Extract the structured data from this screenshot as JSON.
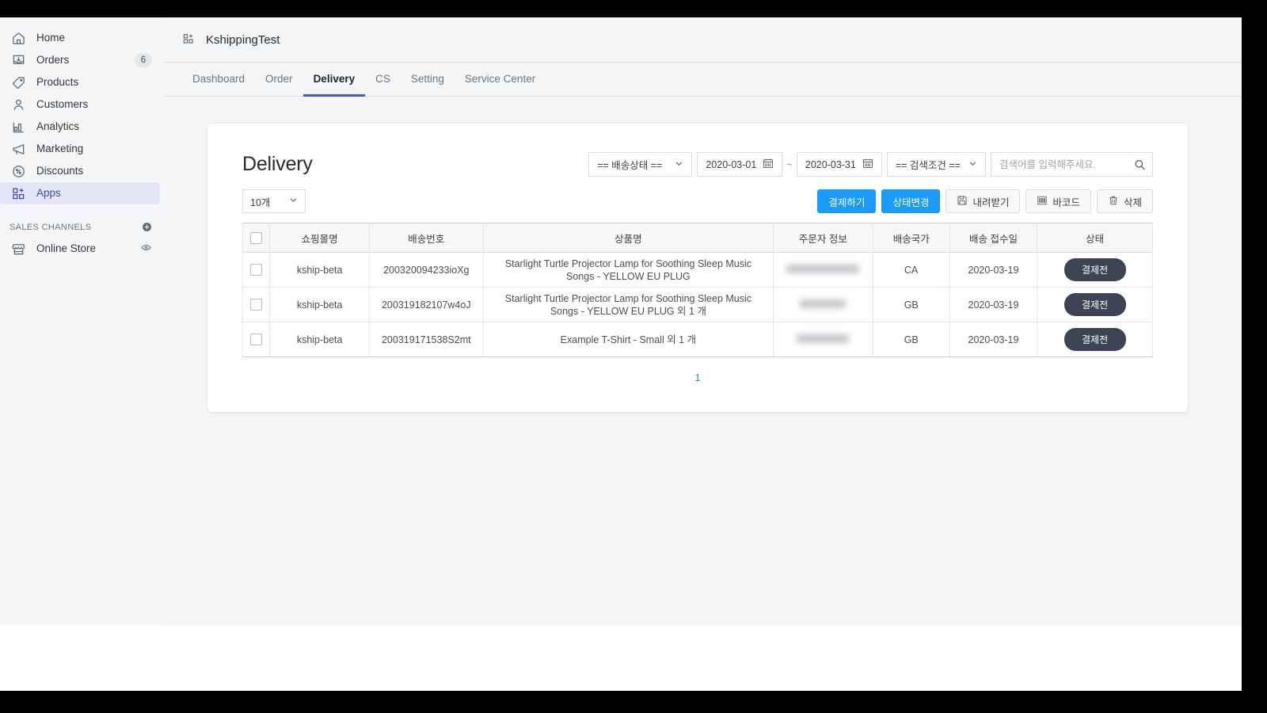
{
  "sidebar": {
    "items": [
      {
        "label": "Home",
        "icon": "home-icon",
        "badge": ""
      },
      {
        "label": "Orders",
        "icon": "orders-icon",
        "badge": "6"
      },
      {
        "label": "Products",
        "icon": "tag-icon",
        "badge": ""
      },
      {
        "label": "Customers",
        "icon": "person-icon",
        "badge": ""
      },
      {
        "label": "Analytics",
        "icon": "bar-chart-icon",
        "badge": ""
      },
      {
        "label": "Marketing",
        "icon": "megaphone-icon",
        "badge": ""
      },
      {
        "label": "Discounts",
        "icon": "discount-icon",
        "badge": ""
      },
      {
        "label": "Apps",
        "icon": "apps-icon",
        "badge": ""
      }
    ],
    "section_title": "SALES CHANNELS",
    "channel": {
      "label": "Online Store",
      "icon": "store-icon",
      "action_icon": "eye-icon"
    },
    "add_icon": "plus-circle-icon"
  },
  "header": {
    "app_icon": "apps-icon",
    "title": "KshippingTest"
  },
  "tabs": [
    {
      "label": "Dashboard",
      "active": false
    },
    {
      "label": "Order",
      "active": false
    },
    {
      "label": "Delivery",
      "active": true
    },
    {
      "label": "CS",
      "active": false
    },
    {
      "label": "Setting",
      "active": false
    },
    {
      "label": "Service Center",
      "active": false
    }
  ],
  "panel": {
    "title": "Delivery",
    "filters": {
      "status_select": "== 배송상태 ==",
      "date_from": "2020-03-01",
      "date_to": "2020-03-31",
      "range_separator": "~",
      "condition_select": "== 검색조건 ==",
      "search_placeholder": "검색어를 입력해주세요.",
      "search_value": "",
      "calendar_icon": "calendar-icon",
      "search_icon": "search-icon",
      "chevron_icon": "chevron-down-icon"
    },
    "page_size": "10개",
    "actions": [
      {
        "label": "결제하기",
        "style": "primary",
        "icon": ""
      },
      {
        "label": "상태변경",
        "style": "primary",
        "icon": ""
      },
      {
        "label": "내려받기",
        "style": "ghost",
        "icon": "save-icon"
      },
      {
        "label": "바코드",
        "style": "ghost",
        "icon": "barcode-icon"
      },
      {
        "label": "삭제",
        "style": "ghost",
        "icon": "trash-icon"
      }
    ],
    "table": {
      "columns": [
        "",
        "쇼핑몰명",
        "배송번호",
        "상품명",
        "주문자 정보",
        "배송국가",
        "배송 접수일",
        "상태"
      ],
      "rows": [
        {
          "mall": "kship-beta",
          "tracking": "200320094233ioXg",
          "product": "Starlight Turtle Projector Lamp for Soothing Sleep Music Songs - YELLOW EU PLUG",
          "buyer": "",
          "buyer_redacted_width": 92,
          "country": "CA",
          "date": "2020-03-19",
          "status": "결제전"
        },
        {
          "mall": "kship-beta",
          "tracking": "200319182107w4oJ",
          "product": "Starlight Turtle Projector Lamp for Soothing Sleep Music Songs - YELLOW EU PLUG 외 1 개",
          "buyer": "",
          "buyer_redacted_width": 58,
          "country": "GB",
          "date": "2020-03-19",
          "status": "결제전"
        },
        {
          "mall": "kship-beta",
          "tracking": "200319171538S2mt",
          "product": "Example T-Shirt - Small 외 1 개",
          "buyer": "",
          "buyer_redacted_width": 66,
          "country": "GB",
          "date": "2020-03-19",
          "status": "결제전"
        }
      ]
    },
    "pagination": {
      "current": "1"
    }
  },
  "colors": {
    "accent_blue": "#1a9bf7",
    "tab_active": "#4959bd",
    "sidebar_active_bg": "#e4e5f7",
    "sidebar_active_fg": "#3f4eae",
    "status_badge": "#3c4456",
    "page_bg": "#f4f5f7",
    "pager_link": "#2196f3"
  }
}
